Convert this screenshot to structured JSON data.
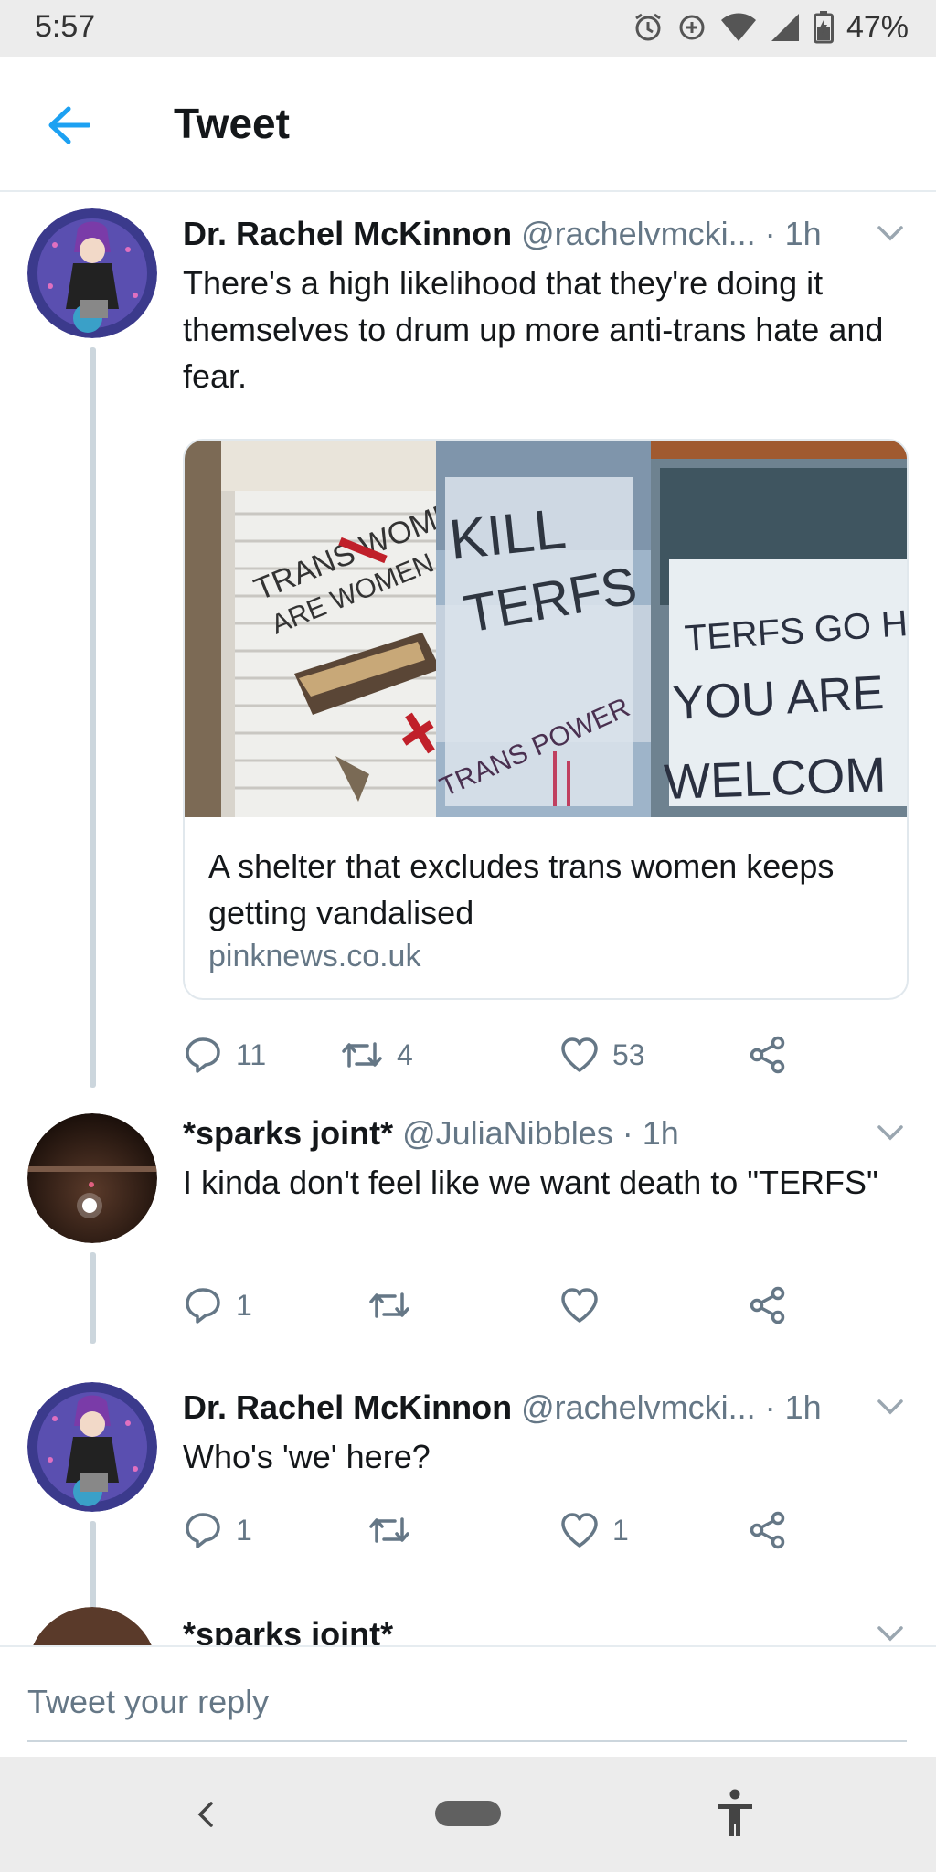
{
  "status_bar": {
    "time": "5:57",
    "battery": "47%"
  },
  "header": {
    "title": "Tweet"
  },
  "tweets": [
    {
      "author_name": "Dr. Rachel McKinnon",
      "handle": "@rachelvmcki...",
      "time": "· 1h",
      "text": "There's a high likelihood that they're doing it themselves to drum up more anti-trans hate and fear.",
      "card": {
        "title": "A shelter that excludes trans women keeps getting vandalised",
        "domain": "pinknews.co.uk",
        "image_text": {
          "panel1_line1": "TRANS WOMEN",
          "panel1_line2": "ARE WOMEN",
          "panel2_line1": "KILL",
          "panel2_line2": "TERFS",
          "panel2_line3": "TRANS POWER",
          "panel3_line1": "TERFS GO H",
          "panel3_line2": "YOU ARE",
          "panel3_line3": "WELCOM"
        }
      },
      "replies": "11",
      "retweets": "4",
      "likes": "53"
    },
    {
      "author_name": "*sparks joint*",
      "handle": "@JuliaNibbles",
      "time": "· 1h",
      "text": "I kinda don't feel like we want death to \"TERFS\"",
      "replies": "1",
      "retweets": "",
      "likes": ""
    },
    {
      "author_name": "Dr. Rachel McKinnon",
      "handle": "@rachelvmcki...",
      "time": "· 1h",
      "text": "Who's 'we' here?",
      "replies": "1",
      "retweets": "",
      "likes": "1"
    },
    {
      "author_name": "*sparks joint*"
    }
  ],
  "reply": {
    "placeholder": "Tweet your reply"
  },
  "colors": {
    "accent": "#1da1f2",
    "text": "#14171a",
    "muted": "#657786",
    "border": "#e1e8ed",
    "thread_line": "#ccd6dd"
  }
}
